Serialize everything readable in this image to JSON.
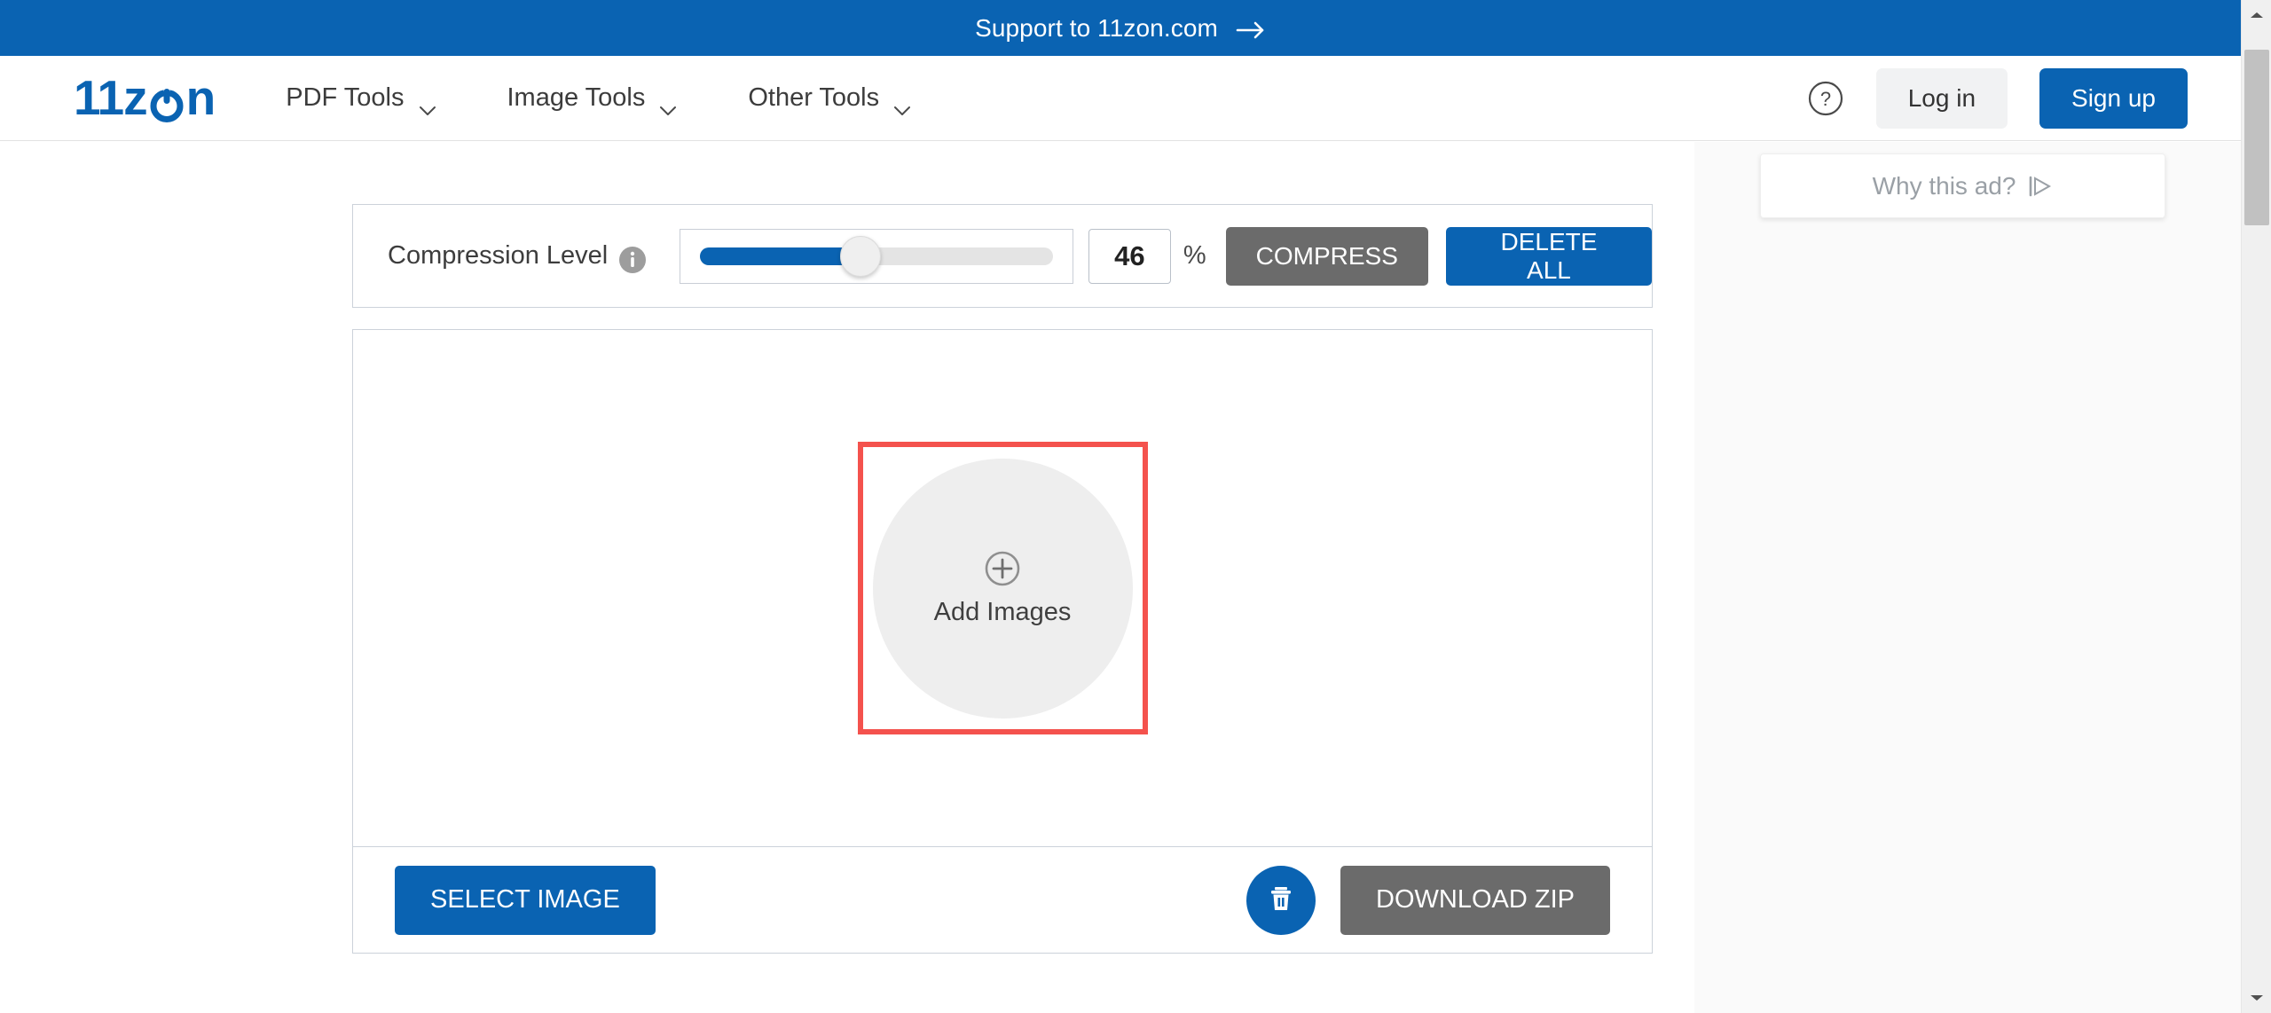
{
  "banner": {
    "text": "Support to 11zon.com",
    "arrow_icon": "arrow-right-icon",
    "background": "#0a63b2"
  },
  "header": {
    "logo": {
      "prefix": "11z",
      "power_icon": "power-symbol-icon",
      "suffix": "n",
      "color": "#0a63b2"
    },
    "nav": [
      {
        "label": "PDF Tools",
        "caret_icon": "chevron-down-icon"
      },
      {
        "label": "Image Tools",
        "caret_icon": "chevron-down-icon"
      },
      {
        "label": "Other Tools",
        "caret_icon": "chevron-down-icon"
      }
    ],
    "help_icon": "question-circle-icon",
    "login_label": "Log in",
    "signup_label": "Sign up"
  },
  "settings": {
    "compression_label": "Compression Level",
    "info_icon": "info-circle-icon",
    "slider": {
      "value": 46,
      "min": 0,
      "max": 100,
      "fill_color": "#0a63b2",
      "track_color": "#e4e4e4"
    },
    "value_field": "46",
    "percent_symbol": "%",
    "compress_label": "COMPRESS",
    "delete_all_label": "DELETE ALL"
  },
  "dropzone": {
    "plus_icon": "plus-circle-icon",
    "add_label": "Add Images",
    "highlight_color": "#f4524d"
  },
  "actions": {
    "select_image_label": "SELECT IMAGE",
    "trash_icon": "trash-icon",
    "download_zip_label": "DOWNLOAD ZIP"
  },
  "ad": {
    "why_this_ad_label": "Why this ad?",
    "adchoices_icon": "adchoices-icon"
  },
  "scrollbar": {
    "up_icon": "caret-up-icon",
    "down_icon": "caret-down-icon"
  }
}
